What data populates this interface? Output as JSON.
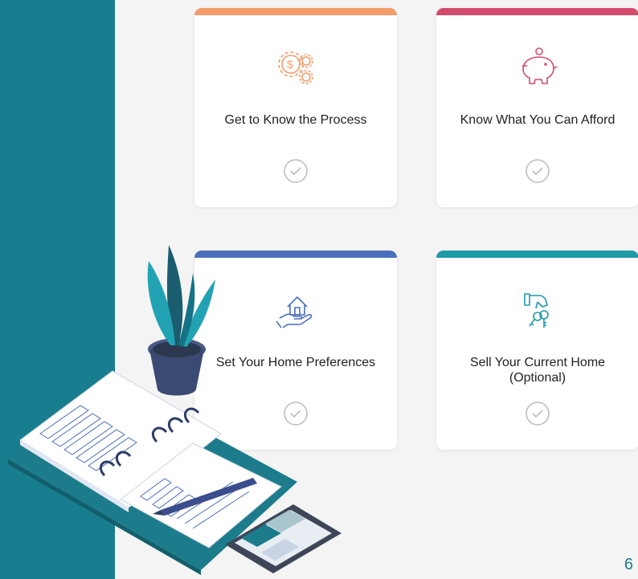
{
  "steps": [
    {
      "title": "Get to Know the Process",
      "accent": "#f39c6b",
      "icon": "gears-dollar-icon",
      "done": false
    },
    {
      "title": "Know What You Can Afford",
      "accent": "#d24b6b",
      "icon": "piggy-bank-icon",
      "done": false
    },
    {
      "title": "Set Your Home Preferences",
      "accent": "#4a6fbd",
      "icon": "home-in-hand-icon",
      "done": false
    },
    {
      "title": "Sell Your Current Home (Optional)",
      "accent": "#1f9aa8",
      "icon": "hand-keys-icon",
      "done": false
    }
  ],
  "page": {
    "number": "6"
  },
  "colors": {
    "sidebar": "#187d8f",
    "background": "#f4f4f4"
  }
}
